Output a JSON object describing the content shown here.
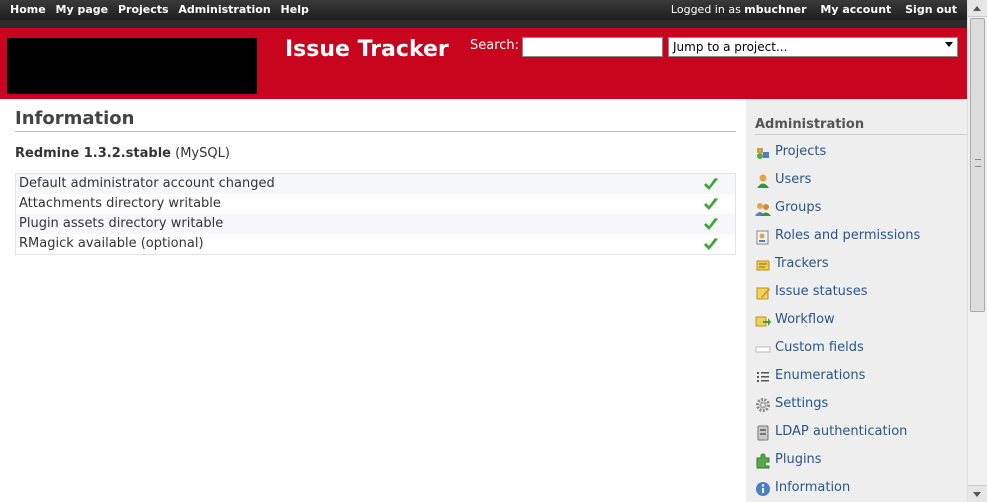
{
  "top_menu": {
    "left": [
      {
        "label": "Home"
      },
      {
        "label": "My page"
      },
      {
        "label": "Projects"
      },
      {
        "label": "Administration"
      },
      {
        "label": "Help"
      }
    ],
    "logged_in_prefix": "Logged in as",
    "username": "mbuchner",
    "my_account": "My account",
    "sign_out": "Sign out"
  },
  "header": {
    "title": "Issue Tracker",
    "search_label": "Search:",
    "search_value": "",
    "jump_placeholder": "Jump to a project..."
  },
  "content": {
    "title": "Information",
    "version": "Redmine 1.3.2.stable",
    "database": "(MySQL)",
    "checks": [
      {
        "label": "Default administrator account changed",
        "icon": "check-icon"
      },
      {
        "label": "Attachments directory writable",
        "icon": "check-icon"
      },
      {
        "label": "Plugin assets directory writable",
        "icon": "check-icon"
      },
      {
        "label": "RMagick available (optional)",
        "icon": "check-icon"
      }
    ]
  },
  "sidebar": {
    "title": "Administration",
    "items": [
      {
        "label": "Projects",
        "icon": "projects-icon"
      },
      {
        "label": "Users",
        "icon": "user-icon"
      },
      {
        "label": "Groups",
        "icon": "group-icon"
      },
      {
        "label": "Roles and permissions",
        "icon": "roles-icon"
      },
      {
        "label": "Trackers",
        "icon": "tracker-icon"
      },
      {
        "label": "Issue statuses",
        "icon": "issue-status-icon"
      },
      {
        "label": "Workflow",
        "icon": "workflow-icon"
      },
      {
        "label": "Custom fields",
        "icon": "custom-fields-icon"
      },
      {
        "label": "Enumerations",
        "icon": "list-icon"
      },
      {
        "label": "Settings",
        "icon": "gear-icon"
      },
      {
        "label": "LDAP authentication",
        "icon": "server-icon"
      },
      {
        "label": "Plugins",
        "icon": "plugin-icon"
      },
      {
        "label": "Information",
        "icon": "info-icon"
      }
    ]
  },
  "colors": {
    "header_red": "#c8041e",
    "link_blue": "#2a5685",
    "check_green": "#3ca63c"
  }
}
